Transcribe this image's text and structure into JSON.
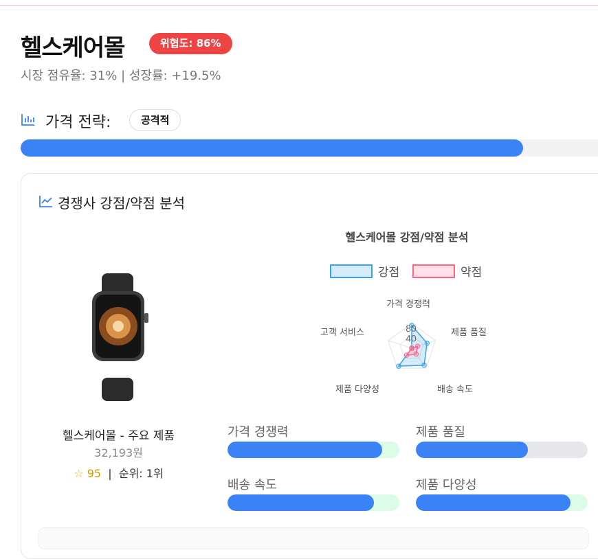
{
  "header": {
    "title": "헬스케어몰",
    "threat_badge": "위협도: 86%",
    "subtitle": "시장 점유율: 31% | 성장률: +19.5%"
  },
  "pricing": {
    "icon": "bar-chart-icon",
    "title": "가격 전략:",
    "strategy": "공격적",
    "level": 0.87
  },
  "analysis": {
    "icon": "line-chart-icon",
    "title": "경쟁사 강점/약점 분석"
  },
  "product": {
    "image": "smartwatch-image",
    "name": "헬스케어몰 - 주요 제품",
    "price": "32,193원",
    "rating_icon": "star-icon",
    "rating": "95",
    "separator": "|",
    "rank": "순위: 1위"
  },
  "chart_data": {
    "type": "radar",
    "title": "헬스케어몰 강점/약점 분석",
    "axes": [
      "가격 경쟁력",
      "제품 품질",
      "배송 속도",
      "제품 다양성",
      "고객 서비스"
    ],
    "tick_labels": [
      "80",
      "40"
    ],
    "range": [
      0,
      100
    ],
    "series": [
      {
        "name": "강점",
        "values": [
          92,
          65,
          85,
          90,
          0
        ],
        "color": "#36a2eb"
      },
      {
        "name": "약점",
        "values": [
          0,
          25,
          30,
          35,
          0
        ],
        "color": "#ff6384"
      }
    ]
  },
  "metrics": [
    {
      "label": "가격 경쟁력",
      "value": 0.9,
      "track": "#dcfce7"
    },
    {
      "label": "제품 품질",
      "value": 0.65,
      "track": "#e5e7eb"
    },
    {
      "label": "배송 속도",
      "value": 0.85,
      "track": "#dcfce7"
    },
    {
      "label": "제품 다양성",
      "value": 0.9,
      "track": "#dcfce7"
    }
  ]
}
